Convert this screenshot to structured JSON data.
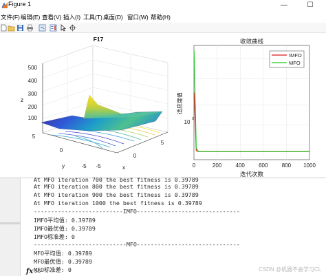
{
  "window": {
    "title": "Figure 1",
    "minimize_glyph": "—",
    "maximize_glyph": "☐"
  },
  "menubar": {
    "items": [
      "文件(F)",
      "编辑(E)",
      "查看(V)",
      "插入(I)",
      "工具(T)",
      "桌面(D)",
      "窗口(W)",
      "帮助(H)"
    ]
  },
  "toolbar": {
    "icons": [
      "new-figure-icon",
      "open-file-icon",
      "save-icon",
      "print-icon",
      "link-icon",
      "insert-colorbar-icon",
      "edit-plot-icon",
      "data-cursor-icon"
    ]
  },
  "chart_data": [
    {
      "type": "surface",
      "title": "F17",
      "zlabel": "z",
      "xlabel": "x",
      "ylabel": "y",
      "zticks": [
        "500",
        "400",
        "300",
        "200",
        "100"
      ],
      "xticks": [
        "-5",
        "0",
        "5"
      ],
      "yticks": [
        "5",
        "0",
        "-5"
      ],
      "xlim": [
        -5,
        5
      ],
      "ylim": [
        -5,
        5
      ],
      "zlim": [
        0,
        500
      ],
      "colormap": "parula",
      "contours_on_floor": true,
      "grid": true
    },
    {
      "type": "line",
      "title": "收敛曲线",
      "xlabel": "迭代次数",
      "ylabel": "适应度值",
      "xticks": [
        "0",
        "200",
        "400",
        "600",
        "800",
        "1000"
      ],
      "yticks": [
        "10",
        "0"
      ],
      "xlim": [
        0,
        1000
      ],
      "yscale": "log",
      "legend_placement": "top-right",
      "grid": true,
      "x": [
        1,
        20,
        40,
        1000
      ],
      "series": [
        {
          "name": "IMFO",
          "color": "#d7191c",
          "values": [
            3.1,
            0.41,
            0.39789,
            0.39789
          ]
        },
        {
          "name": "MFO",
          "color": "#1ec91e",
          "values": [
            13.5,
            0.45,
            0.39789,
            0.39789
          ]
        }
      ]
    }
  ],
  "command_window": {
    "lines": [
      "At MFO iteration 700 the best fitness is 0.39789",
      "At MFO iteration 800 the best fitness is 0.39789",
      "At MFO iteration 900 the best fitness is 0.39789",
      "At MFO iteration 1000 the best fitness is 0.39789",
      "--------------------------IMFO------------------------------",
      "IMFO平均值: 0.39789",
      "IMFO最优值: 0.39789",
      "IMFO标准差: 0",
      "---------------------------MFO------------------------------",
      "MFO平均值: 0.39789",
      "MFO最优值: 0.39789",
      "MFO标准差: 0"
    ],
    "fx_label": "fx",
    "prompt": ">>"
  },
  "watermark": "CSDN @机器不会学习CL"
}
